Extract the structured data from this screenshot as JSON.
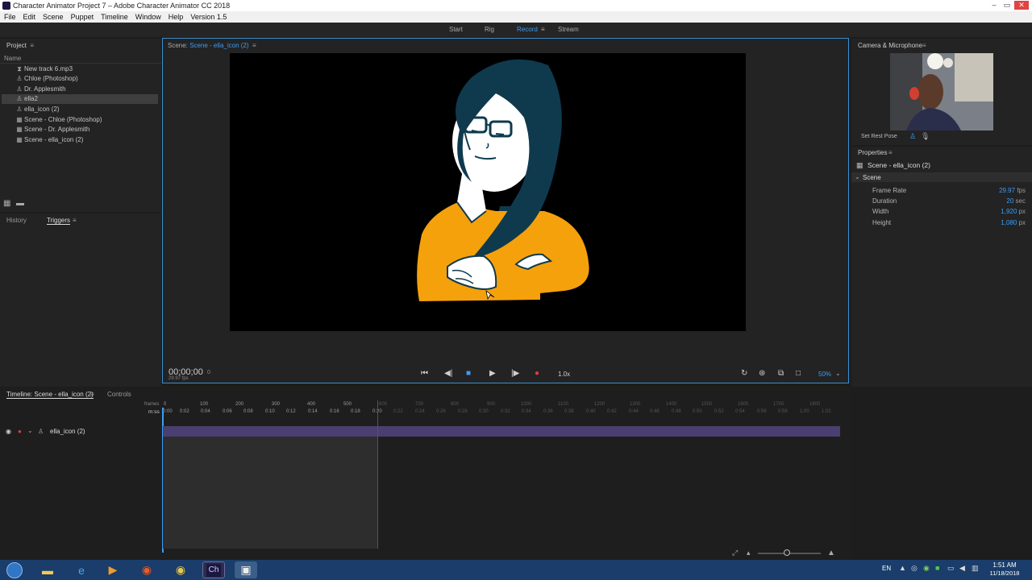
{
  "window": {
    "title": "Character Animator Project 7 – Adobe Character Animator CC 2018"
  },
  "menu": [
    "File",
    "Edit",
    "Scene",
    "Puppet",
    "Timeline",
    "Window",
    "Help",
    "Version 1.5"
  ],
  "workspaces": {
    "start": "Start",
    "rig": "Rig",
    "record": "Record",
    "stream": "Stream"
  },
  "project": {
    "title": "Project",
    "column": "Name",
    "items": [
      {
        "label": "New track 6.mp3",
        "icon": "audio-icon"
      },
      {
        "label": "Chloe (Photoshop)",
        "icon": "puppet-icon"
      },
      {
        "label": "Dr. Applesmith",
        "icon": "puppet-icon"
      },
      {
        "label": "ella2",
        "icon": "puppet-icon"
      },
      {
        "label": "ella_icon (2)",
        "icon": "puppet-icon"
      },
      {
        "label": "Scene - Chloe (Photoshop)",
        "icon": "scene-icon"
      },
      {
        "label": "Scene - Dr. Applesmith",
        "icon": "scene-icon"
      },
      {
        "label": "Scene - ella_icon (2)",
        "icon": "scene-icon"
      }
    ]
  },
  "history_panel": {
    "history_tab": "History",
    "triggers_tab": "Triggers"
  },
  "scene_panel": {
    "label": "Scene:",
    "name": "Scene - ella_icon (2)",
    "timecode": "00;00;00",
    "frame": "0",
    "fps": "29.97 fps",
    "speed": "1.0x",
    "zoom": "50%"
  },
  "camera": {
    "title": "Camera & Microphone",
    "rest_pose": "Set Rest Pose"
  },
  "properties": {
    "title": "Properties",
    "scene_name": "Scene - ella_icon (2)",
    "section": "Scene",
    "rows": [
      {
        "label": "Frame Rate",
        "value": "29.97",
        "unit": "fps"
      },
      {
        "label": "Duration",
        "value": "20",
        "unit": "sec"
      },
      {
        "label": "Width",
        "value": "1,920",
        "unit": "px"
      },
      {
        "label": "Height",
        "value": "1,080",
        "unit": "px"
      }
    ]
  },
  "timeline": {
    "tab": "Timeline: Scene - ella_icon (2)",
    "controls_tab": "Controls",
    "frames_label": "frames",
    "time_label": "m:ss",
    "frame_ticks": [
      "0",
      "100",
      "200",
      "300",
      "400",
      "500"
    ],
    "time_ticks": [
      "0:00",
      "0:02",
      "0:04",
      "0:06",
      "0:08",
      "0:10",
      "0:12",
      "0:14",
      "0:16",
      "0:18",
      "0:20"
    ],
    "frame_ticks_past": [
      "600",
      "700",
      "800",
      "900",
      "1000",
      "1100",
      "1200",
      "1300",
      "1400",
      "1500",
      "1600",
      "1700",
      "1800"
    ],
    "time_ticks_past": [
      "0:22",
      "0:24",
      "0:26",
      "0:28",
      "0:30",
      "0:32",
      "0:34",
      "0:36",
      "0:38",
      "0:40",
      "0:42",
      "0:44",
      "0:46",
      "0:48",
      "0:50",
      "0:52",
      "0:54",
      "0:56",
      "0:58",
      "1:00",
      "1:02"
    ],
    "track": "ella_icon (2)"
  },
  "taskbar": {
    "lang": "EN",
    "time": "1:51 AM",
    "date": "11/18/2018",
    "ch_label": "Ch"
  },
  "colors": {
    "accent": "#3b9cf5",
    "record": "#e03c3c",
    "shirt": "#f5a10c",
    "hair": "#0f3a4d"
  }
}
